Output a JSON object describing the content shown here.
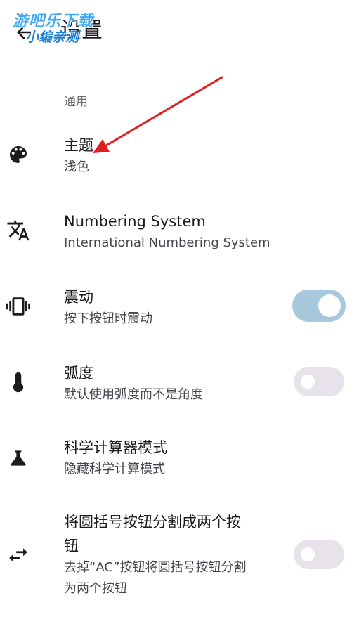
{
  "app_bar": {
    "title": "设置",
    "back_icon": "arrow-back-icon"
  },
  "watermark": {
    "line1": "游吧乐下载",
    "line2": "小编亲测"
  },
  "section": {
    "header": "通用"
  },
  "prefs": [
    {
      "icon": "palette-icon",
      "title": "主题",
      "summary": "浅色"
    },
    {
      "icon": "translate-icon",
      "title": "Numbering System",
      "summary": "International Numbering System"
    },
    {
      "icon": "vibration-icon",
      "title": "震动",
      "summary": "按下按钮时震动",
      "toggle": true
    },
    {
      "icon": "thermometer-icon",
      "title": "弧度",
      "summary": "默认使用弧度而不是角度",
      "toggle": false
    },
    {
      "icon": "flask-icon",
      "title": "科学计算器模式",
      "summary": "隐藏科学计算模式"
    },
    {
      "icon": "swap-horiz-icon",
      "title_line1": "将圆括号按钮分割成两个按",
      "title_line2": "钮",
      "summary_line1": "去掉“AC”按钮将圆括号按钮分割",
      "summary_line2": "为两个按钮",
      "toggle": false
    }
  ],
  "colors": {
    "toggle_on_track": "#a8c8dc",
    "toggle_off_track": "#e8e3ea",
    "annotation_arrow": "#e02020"
  }
}
